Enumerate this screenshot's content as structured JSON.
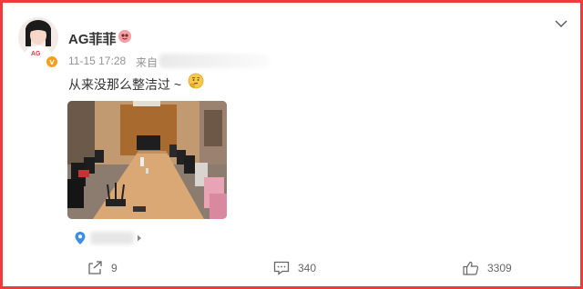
{
  "post": {
    "username": "AG菲菲",
    "timestamp": "11-15 17:28",
    "source_prefix": "来自",
    "text": "从来没那么整洁过 ~",
    "emoji": "thinking-face",
    "location_label": ""
  },
  "actions": {
    "repost_count": "9",
    "comment_count": "340",
    "like_count": "3309"
  },
  "icons": {
    "menu": "chevron-down-icon",
    "verified": "verified-badge-icon",
    "member": "member-badge-icon",
    "location": "location-pin-icon",
    "repost": "repost-icon",
    "comment": "comment-icon",
    "like": "thumbs-up-icon"
  },
  "colors": {
    "frame_border": "#ee3b3b",
    "verified_badge": "#f7a01b",
    "location_pin": "#4a90e2",
    "text_primary": "#333333",
    "text_muted": "#939393"
  }
}
